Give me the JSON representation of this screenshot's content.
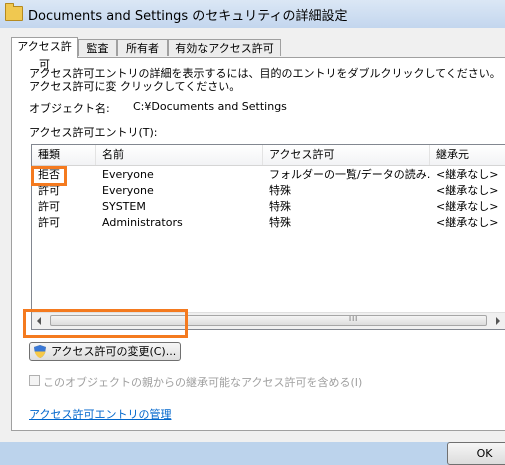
{
  "window": {
    "title": "Documents and Settings のセキュリティの詳細設定"
  },
  "tabs": [
    {
      "label": "アクセス許可",
      "active": true
    },
    {
      "label": "監査"
    },
    {
      "label": "所有者"
    },
    {
      "label": "有効なアクセス許可"
    }
  ],
  "panel": {
    "description": "アクセス許可エントリの詳細を表示するには、目的のエントリをダブルクリックしてください。アクセス許可に変更するには、エントリを選択し、[編集] をクリックしてください。",
    "description_visible": "アクセス許可エントリの詳細を表示するには、目的のエントリをダブルクリックしてください。アクセス許可に変 クリックしてください。",
    "object_label": "オブジェクト名:",
    "object_value": "C:¥Documents and Settings",
    "entries_label": "アクセス許可エントリ(T):",
    "columns": [
      "種類",
      "名前",
      "アクセス許可",
      "継承元"
    ],
    "rows": [
      {
        "type": "拒否",
        "name": "Everyone",
        "permission": "フォルダーの一覧/データの読み…",
        "inherited": "<継承なし>"
      },
      {
        "type": "許可",
        "name": "Everyone",
        "permission": "特殊",
        "inherited": "<継承なし>"
      },
      {
        "type": "許可",
        "name": "SYSTEM",
        "permission": "特殊",
        "inherited": "<継承なし>"
      },
      {
        "type": "許可",
        "name": "Administrators",
        "permission": "特殊",
        "inherited": "<継承なし>"
      }
    ],
    "change_button": "アクセス許可の変更(C)...",
    "inherit_checkbox": "このオブジェクトの親からの継承可能なアクセス許可を含める(I)",
    "inherit_checked": false,
    "manage_link": "アクセス許可エントリの管理"
  },
  "ok_button": "OK",
  "colors": {
    "highlight": "#f47a1f",
    "link": "#0066cc"
  }
}
